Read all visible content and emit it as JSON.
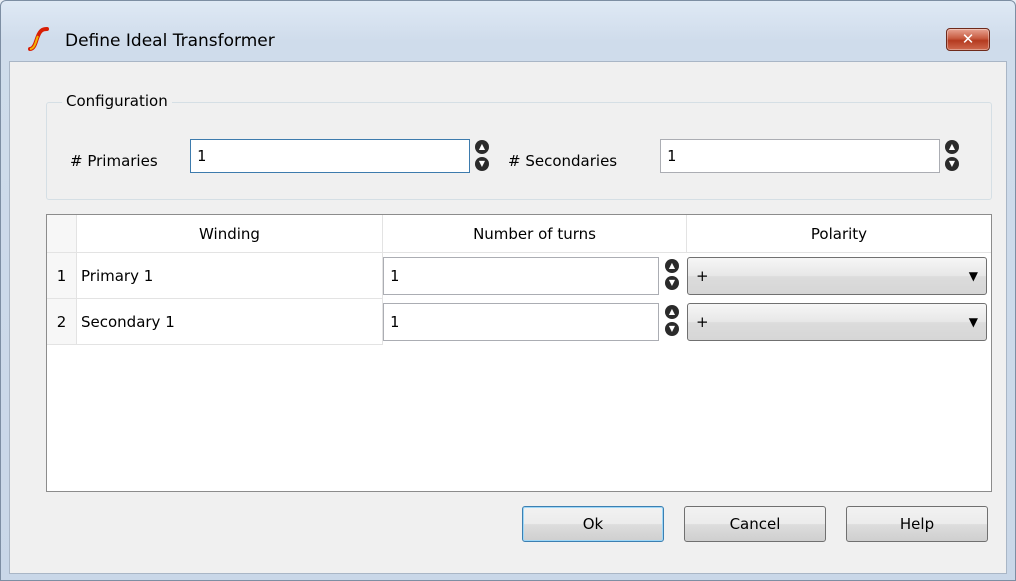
{
  "window": {
    "title": "Define Ideal Transformer",
    "close_symbol": "✕"
  },
  "config": {
    "legend": "Configuration",
    "primaries_label": "# Primaries",
    "primaries_value": "1",
    "secondaries_label": "# Secondaries",
    "secondaries_value": "1"
  },
  "table": {
    "headers": [
      "Winding",
      "Number of turns",
      "Polarity"
    ],
    "rows": [
      {
        "num": "1",
        "winding": "Primary 1",
        "turns": "1",
        "polarity": "+"
      },
      {
        "num": "2",
        "winding": "Secondary 1",
        "turns": "1",
        "polarity": "+"
      }
    ]
  },
  "buttons": {
    "ok": "Ok",
    "cancel": "Cancel",
    "help": "Help"
  },
  "icons": {
    "app": "app-logo-icon",
    "spin": "spinner-icon",
    "dropdown": "chevron-down-icon"
  },
  "colors": {
    "close_red": "#c75a40",
    "focus_border": "#3d7bad"
  }
}
